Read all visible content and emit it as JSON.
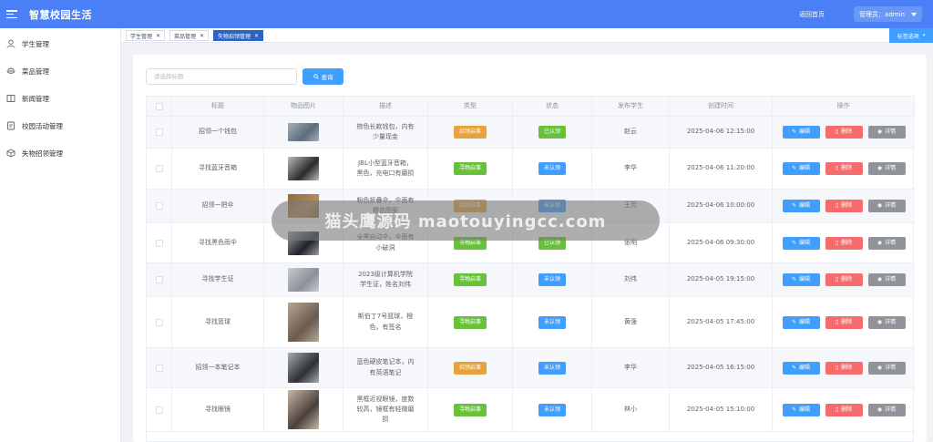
{
  "header": {
    "title": "智慧校园生活",
    "home_link": "返回首页",
    "user_label": "管理员：admin"
  },
  "sidebar": {
    "items": [
      {
        "label": "学生管理",
        "icon": "user-icon"
      },
      {
        "label": "菜品管理",
        "icon": "dish-icon"
      },
      {
        "label": "新闻管理",
        "icon": "book-icon"
      },
      {
        "label": "校园活动管理",
        "icon": "calendar-icon"
      },
      {
        "label": "失物招领管理",
        "icon": "box-icon"
      }
    ]
  },
  "tabs": [
    {
      "label": "学生管理",
      "active": false
    },
    {
      "label": "菜品管理",
      "active": false
    },
    {
      "label": "失物招领管理",
      "active": true
    }
  ],
  "tab_ops_label": "标签选项",
  "search": {
    "placeholder": "请选择标题",
    "button_label": "查询"
  },
  "table": {
    "columns": [
      "标题",
      "物品图片",
      "描述",
      "类型",
      "状态",
      "发布学生",
      "创建时间",
      "操作"
    ],
    "rows": [
      {
        "title": "招领一个钱包",
        "desc": "棕色长款钱包，内有少量现金",
        "type": "招领启事",
        "status": "已认领",
        "student": "赵云",
        "time": "2025-04-06 12:15:00"
      },
      {
        "title": "寻找蓝牙音箱",
        "desc": "JBL小型蓝牙音箱，黑色，充电口有磨损",
        "type": "寻物启事",
        "status": "未认领",
        "student": "李华",
        "time": "2025-04-06 11:20:00"
      },
      {
        "title": "招领一把伞",
        "desc": "粉色折叠伞，伞面有樱花图案",
        "type": "招领启事",
        "status": "未认领",
        "student": "王芳",
        "time": "2025-04-06 10:00:00"
      },
      {
        "title": "寻找黑色雨伞",
        "desc": "全黑自动伞，伞面有小破洞",
        "type": "寻物启事",
        "status": "已认领",
        "student": "张明",
        "time": "2025-04-06 09:30:00"
      },
      {
        "title": "寻找学生证",
        "desc": "2023级计算机学院学生证，姓名刘伟",
        "type": "寻物启事",
        "status": "未认领",
        "student": "刘伟",
        "time": "2025-04-05 19:15:00"
      },
      {
        "title": "寻找篮球",
        "desc": "斯伯丁7号篮球，橙色，有签名",
        "type": "寻物启事",
        "status": "未认领",
        "student": "黄强",
        "time": "2025-04-05 17:45:00"
      },
      {
        "title": "招领一本笔记本",
        "desc": "蓝色硬皮笔记本，内有英语笔记",
        "type": "招领启事",
        "status": "未认领",
        "student": "李华",
        "time": "2025-04-05 16:15:00"
      },
      {
        "title": "寻找眼镜",
        "desc": "黑框近视眼镜，度数较高，镜框有轻微磨损",
        "type": "寻物启事",
        "status": "未认领",
        "student": "林小",
        "time": "2025-04-05 15:10:00"
      }
    ],
    "actions": {
      "edit": "编辑",
      "delete": "删除",
      "detail": "详情"
    }
  },
  "watermark": "猫头鹰源码 maotouyingcc.com",
  "colors": {
    "header": "#4a7ff5",
    "primary": "#409eff",
    "tag_found": "#e6a23c",
    "tag_lost": "#67c23a",
    "status_claimed": "#67c23a",
    "status_unclaimed": "#409eff",
    "danger": "#f56c6c",
    "info": "#909399"
  }
}
